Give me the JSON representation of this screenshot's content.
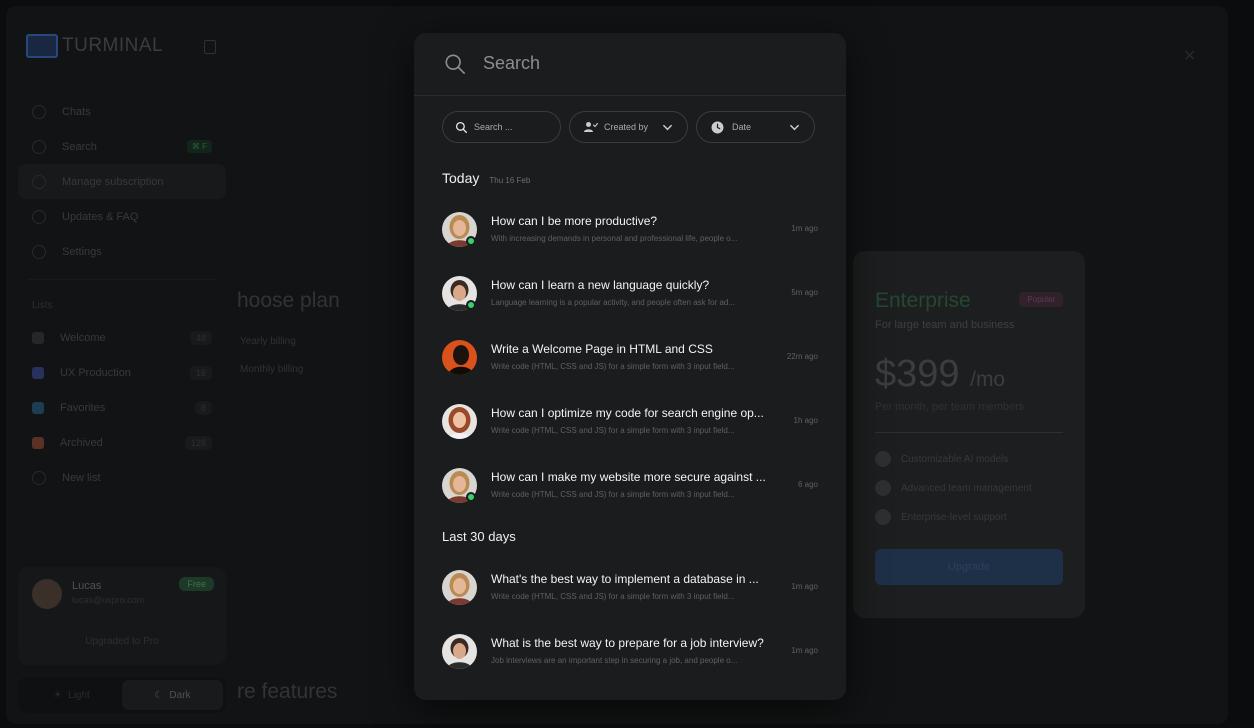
{
  "app": {
    "logo_text": "TURMINAL",
    "nav": [
      {
        "label": "Chats",
        "icon": "chat-icon"
      },
      {
        "label": "Search",
        "icon": "search-icon",
        "shortcut": "⌘ F"
      },
      {
        "label": "Manage subscription",
        "icon": "card-icon"
      },
      {
        "label": "Updates & FAQ",
        "icon": "sparkle-icon"
      },
      {
        "label": "Settings",
        "icon": "gear-icon"
      }
    ],
    "lists_title": "Lists",
    "lists": [
      {
        "label": "Welcome",
        "count": "48",
        "color": "#3a3c40"
      },
      {
        "label": "UX Production",
        "count": "16",
        "color": "#3d4c8c"
      },
      {
        "label": "Favorites",
        "count": "8",
        "color": "#2c5f7e"
      },
      {
        "label": "Archived",
        "count": "128",
        "color": "#8c4a3a"
      }
    ],
    "new_list": "New list",
    "user": {
      "name": "Lucas",
      "email": "lucas@uxpro.com",
      "plan_badge": "Free",
      "upgraded": "Upgraded to Pro"
    },
    "theme": {
      "light": "Light",
      "dark": "Dark"
    },
    "plan_heading": "hoose plan",
    "billing_monthly": "Monthly billing",
    "billing_yearly": "Yearly billing",
    "features_heading": "re features",
    "enterprise": {
      "title": "Enterprise",
      "badge": "Popular",
      "desc": "For large team and business",
      "price": "$399",
      "price_unit": "/mo",
      "note": "Per month, per team members",
      "features": [
        "Customizable AI models",
        "Advanced team management",
        "Enterprise-level support"
      ],
      "button": "Upgrade"
    }
  },
  "modal": {
    "search_label": "Search",
    "filters": {
      "search_placeholder": "Search ...",
      "created_by": "Created by",
      "date": "Date"
    },
    "sections": [
      {
        "title": "Today",
        "date": "Thu 16 Feb",
        "items": [
          {
            "title": "How can I be more productive?",
            "preview": "With increasing demands in personal and professional life, people o...",
            "time": "1m ago",
            "online": true,
            "avatar": "woman-blonde"
          },
          {
            "title": "How can I learn a new language quickly?",
            "preview": "Language learning is a popular activity, and people often ask for ad...",
            "time": "5m ago",
            "online": true,
            "avatar": "man-dark"
          },
          {
            "title": "Write a Welcome Page in HTML and CSS",
            "preview": "Write code (HTML, CSS and JS) for a simple form with 3 input field...",
            "time": "22m ago",
            "online": false,
            "avatar": "man-orange"
          },
          {
            "title": "How can I optimize my code for search engine op...",
            "preview": "Write code (HTML, CSS and JS) for a simple form with 3 input field...",
            "time": "1h ago",
            "online": false,
            "avatar": "woman-red"
          },
          {
            "title": "How can I make my website more secure against ...",
            "preview": "Write code (HTML, CSS and JS) for a simple form with 3 input field...",
            "time": "6 ago",
            "online": true,
            "avatar": "woman-blonde"
          }
        ]
      },
      {
        "title": "Last 30 days",
        "date": "",
        "items": [
          {
            "title": "What's the best way to implement a database in ...",
            "preview": "Write code (HTML, CSS and JS) for a simple form with 3 input field...",
            "time": "1m ago",
            "online": false,
            "avatar": "woman-blonde"
          },
          {
            "title": "What is the best way to prepare for a job interview?",
            "preview": "Job interviews are an important step in securing a job, and people o...",
            "time": "1m ago",
            "online": false,
            "avatar": "man-dark"
          }
        ]
      }
    ]
  }
}
